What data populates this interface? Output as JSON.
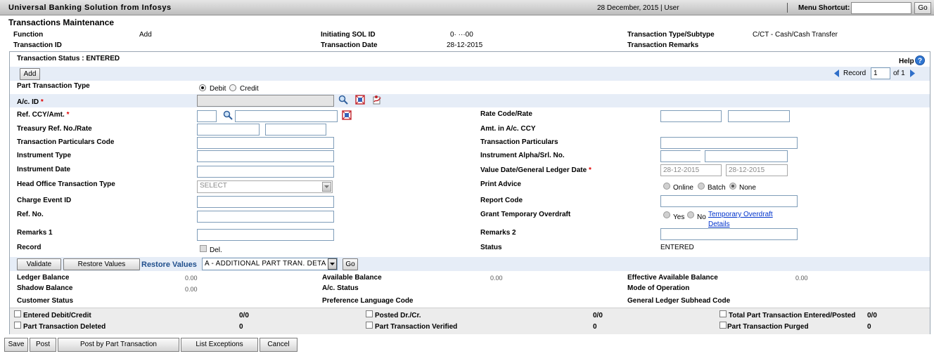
{
  "app": {
    "title": "Universal Banking Solution from Infosys",
    "date_user": "28 December, 2015  |  User",
    "menu_shortcut_label": "Menu Shortcut:",
    "go_label": "Go"
  },
  "page_title": "Transactions Maintenance",
  "header": {
    "function_label": "Function",
    "function_value": "Add",
    "transaction_id_label": "Transaction ID",
    "initiating_sol_label": "Initiating SOL ID",
    "initiating_sol_value": "0· ···00",
    "transaction_date_label": "Transaction Date",
    "transaction_date_value": "28-12-2015",
    "type_subtype_label": "Transaction Type/Subtype",
    "type_subtype_value": "C/CT - Cash/Cash Transfer",
    "remarks_label": "Transaction Remarks"
  },
  "status_line": "Transaction Status : ENTERED",
  "help_label": "Help",
  "add_button": "Add",
  "record_nav": {
    "label": "Record",
    "value": "1",
    "of": "of 1"
  },
  "form": {
    "part_tran_type_label": "Part Transaction Type",
    "debit_label": "Debit",
    "credit_label": "Credit",
    "ac_id_label": "A/c. ID",
    "ref_ccy_label": "Ref. CCY/Amt.",
    "treasury_label": "Treasury Ref. No./Rate",
    "tran_particulars_code_label": "Transaction Particulars Code",
    "instrument_type_label": "Instrument Type",
    "instrument_date_label": "Instrument Date",
    "ho_tran_type_label": "Head Office Transaction Type",
    "ho_tran_type_value": "SELECT",
    "charge_event_label": "Charge Event ID",
    "ref_no_label": "Ref. No.",
    "remarks1_label": "Remarks 1",
    "record_label": "Record",
    "del_label": "Del.",
    "rate_code_label": "Rate Code/Rate",
    "amt_ac_ccy_label": "Amt. in A/c. CCY",
    "tran_particulars_label": "Transaction Particulars",
    "instrument_alpha_label": "Instrument Alpha/Srl. No.",
    "value_date_label": "Value Date/General Ledger Date",
    "value_date_1": "28-12-2015",
    "value_date_2": "28-12-2015",
    "print_advice_label": "Print Advice",
    "print_online": "Online",
    "print_batch": "Batch",
    "print_none": "None",
    "report_code_label": "Report Code",
    "grant_od_label": "Grant Temporary Overdraft",
    "od_yes": "Yes",
    "od_no": "No",
    "od_link_line1": "Temporary Overdraft",
    "od_link_line2": "Details",
    "remarks2_label": "Remarks 2",
    "status_label": "Status",
    "status_value": "ENTERED"
  },
  "action_bar": {
    "validate": "Validate",
    "restore_values_btn": "Restore Values",
    "restore_values_label": "Restore Values",
    "dropdown_value": "A - ADDITIONAL PART TRAN. DETA",
    "go": "Go"
  },
  "balances": {
    "ledger_label": "Ledger Balance",
    "ledger_value": "0.00",
    "shadow_label": "Shadow Balance",
    "shadow_value": "0.00",
    "customer_status_label": "Customer Status",
    "available_label": "Available Balance",
    "available_value": "0.00",
    "ac_status_label": "A/c. Status",
    "pref_lang_label": "Preference Language Code",
    "effective_label": "Effective Available Balance",
    "effective_value": "0.00",
    "mode_label": "Mode of Operation",
    "gl_subhead_label": "General Ledger Subhead Code"
  },
  "summary": {
    "entered_label": "Entered Debit/Credit",
    "entered_value": "0/0",
    "deleted_label": "Part Transaction Deleted",
    "deleted_value": "0",
    "posted_label": "Posted Dr./Cr.",
    "posted_value": "0/0",
    "verified_label": "Part Transaction Verified",
    "verified_value": "0",
    "total_label": "Total Part Transaction Entered/Posted",
    "total_value": "0/0",
    "purged_label": "Part Transaction Purged",
    "purged_value": "0"
  },
  "footer": {
    "save": "Save",
    "post": "Post",
    "post_by_part": "Post by Part Transaction",
    "list_exceptions": "List Exceptions",
    "cancel": "Cancel"
  }
}
